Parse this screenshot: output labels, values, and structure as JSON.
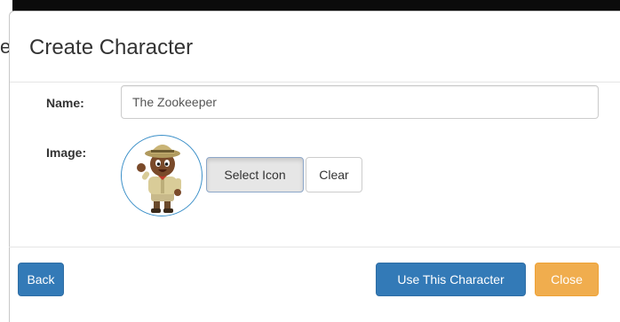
{
  "background": {
    "partial_title_letter": "e"
  },
  "dialog": {
    "title": "Create Character",
    "name_label": "Name:",
    "name_value": "The Zookeeper",
    "image_label": "Image:",
    "avatar_icon": "zookeeper-character-icon",
    "select_icon_label": "Select Icon",
    "clear_label": "Clear"
  },
  "footer": {
    "back_label": "Back",
    "use_label": "Use This Character",
    "close_label": "Close"
  },
  "colors": {
    "primary": "#337ab7",
    "warning": "#f0ad4e",
    "avatar_border": "#3a8fc8"
  }
}
